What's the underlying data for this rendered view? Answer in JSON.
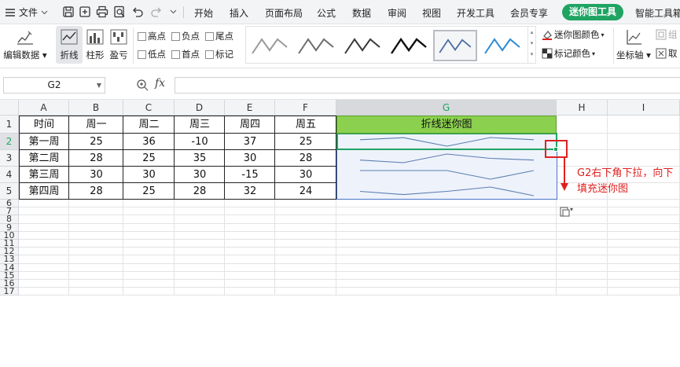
{
  "menubar": {
    "file_label": "文件",
    "tabs": [
      "开始",
      "插入",
      "页面布局",
      "公式",
      "数据",
      "审阅",
      "视图",
      "开发工具",
      "会员专享"
    ],
    "active_tab": "迷你图工具",
    "next_tab": "智能工具箱"
  },
  "ribbon": {
    "edit_data": "编辑数据",
    "type_line": "折线",
    "type_column": "柱形",
    "type_winloss": "盈亏",
    "checks": [
      "高点",
      "负点",
      "尾点",
      "低点",
      "首点",
      "标记"
    ],
    "sparkline_color": "迷你图颜色",
    "marker_color": "标记颜色",
    "axis": "坐标轴",
    "combine": "组",
    "cancel": "取"
  },
  "formulabar": {
    "namebox": "G2",
    "fx": "fx",
    "value": ""
  },
  "grid": {
    "columns": [
      "A",
      "B",
      "C",
      "D",
      "E",
      "F",
      "G",
      "H",
      "I"
    ],
    "rows": [
      "1",
      "2",
      "3",
      "4",
      "5",
      "6",
      "7",
      "8",
      "9",
      "10",
      "11",
      "12",
      "13",
      "14",
      "15",
      "16",
      "17"
    ],
    "header": [
      "时间",
      "周一",
      "周二",
      "周三",
      "周四",
      "周五",
      "折线迷你图"
    ],
    "data": [
      [
        "第一周",
        "25",
        "36",
        "-10",
        "37",
        "25"
      ],
      [
        "第二周",
        "28",
        "25",
        "35",
        "30",
        "28"
      ],
      [
        "第三周",
        "30",
        "30",
        "30",
        "-15",
        "30"
      ],
      [
        "第四周",
        "28",
        "25",
        "28",
        "32",
        "24"
      ]
    ],
    "sparklines": [
      [
        25,
        36,
        -10,
        37,
        25
      ],
      [
        28,
        25,
        35,
        30,
        28
      ],
      [
        30,
        30,
        30,
        -15,
        30
      ],
      [
        28,
        25,
        28,
        32,
        24
      ]
    ]
  },
  "annotation": "G2右下角下拉，向下填充迷你图",
  "colors": {
    "accent": "#1fa463",
    "header_fill": "#8bd04e",
    "sparkline": "#5b7db1",
    "annotation": "#e02020"
  }
}
